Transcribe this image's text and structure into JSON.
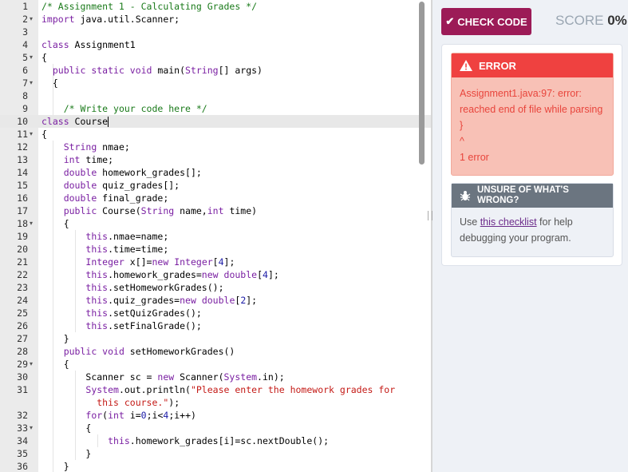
{
  "editor": {
    "lines": [
      {
        "n": "1",
        "fold": "",
        "indent": 0,
        "html": "<span class='cm'>/* Assignment 1 - Calculating Grades */</span>"
      },
      {
        "n": "2",
        "fold": "▾",
        "indent": 0,
        "html": "<span class='kw'>import</span> java.util.Scanner;"
      },
      {
        "n": "3",
        "fold": "",
        "indent": 0,
        "html": ""
      },
      {
        "n": "4",
        "fold": "",
        "indent": 0,
        "html": "<span class='kw'>class</span> Assignment1"
      },
      {
        "n": "5",
        "fold": "▾",
        "indent": 0,
        "html": "{"
      },
      {
        "n": "6",
        "fold": "",
        "indent": 1,
        "html": "  <span class='kw'>public static void</span> main(<span class='kw'>String</span>[] args)"
      },
      {
        "n": "7",
        "fold": "▾",
        "indent": 1,
        "html": "  {"
      },
      {
        "n": "8",
        "fold": "",
        "indent": 1,
        "html": ""
      },
      {
        "n": "9",
        "fold": "",
        "indent": 1,
        "html": "    <span class='cm'>/* Write your code here */</span>"
      },
      {
        "n": "10",
        "fold": "",
        "indent": 0,
        "active": true,
        "html": "<span class='kw'>class</span> Course<span class='cursor'></span>"
      },
      {
        "n": "11",
        "fold": "▾",
        "indent": 0,
        "html": "{"
      },
      {
        "n": "12",
        "fold": "",
        "indent": 1,
        "html": "    <span class='kw'>String</span> nmae;"
      },
      {
        "n": "13",
        "fold": "",
        "indent": 1,
        "html": "    <span class='kw'>int</span> time;"
      },
      {
        "n": "14",
        "fold": "",
        "indent": 1,
        "html": "    <span class='kw'>double</span> homework_grades[];"
      },
      {
        "n": "15",
        "fold": "",
        "indent": 1,
        "html": "    <span class='kw'>double</span> quiz_grades[];"
      },
      {
        "n": "16",
        "fold": "",
        "indent": 1,
        "html": "    <span class='kw'>double</span> final_grade;"
      },
      {
        "n": "17",
        "fold": "",
        "indent": 1,
        "html": "    <span class='kw'>public</span> Course(<span class='kw'>String</span> name,<span class='kw'>int</span> time)"
      },
      {
        "n": "18",
        "fold": "▾",
        "indent": 1,
        "html": "    {"
      },
      {
        "n": "19",
        "fold": "",
        "indent": 2,
        "html": "        <span class='kw'>this</span>.nmae=name;"
      },
      {
        "n": "20",
        "fold": "",
        "indent": 2,
        "html": "        <span class='kw'>this</span>.time=time;"
      },
      {
        "n": "21",
        "fold": "",
        "indent": 2,
        "html": "        <span class='kw'>Integer</span> x[]=<span class='kw'>new</span> <span class='kw'>Integer</span>[<span class='num'>4</span>];"
      },
      {
        "n": "22",
        "fold": "",
        "indent": 2,
        "html": "        <span class='kw'>this</span>.homework_grades=<span class='kw'>new</span> <span class='kw'>double</span>[<span class='num'>4</span>];"
      },
      {
        "n": "23",
        "fold": "",
        "indent": 2,
        "html": "        <span class='kw'>this</span>.setHomeworkGrades();"
      },
      {
        "n": "24",
        "fold": "",
        "indent": 2,
        "html": "        <span class='kw'>this</span>.quiz_grades=<span class='kw'>new</span> <span class='kw'>double</span>[<span class='num'>2</span>];"
      },
      {
        "n": "25",
        "fold": "",
        "indent": 2,
        "html": "        <span class='kw'>this</span>.setQuizGrades();"
      },
      {
        "n": "26",
        "fold": "",
        "indent": 2,
        "html": "        <span class='kw'>this</span>.setFinalGrade();"
      },
      {
        "n": "27",
        "fold": "",
        "indent": 1,
        "html": "    }"
      },
      {
        "n": "28",
        "fold": "",
        "indent": 1,
        "html": "    <span class='kw'>public void</span> setHomeworkGrades()"
      },
      {
        "n": "29",
        "fold": "▾",
        "indent": 1,
        "html": "    {"
      },
      {
        "n": "30",
        "fold": "",
        "indent": 2,
        "html": "        Scanner sc = <span class='kw'>new</span> Scanner(<span class='kw'>System</span>.in);"
      },
      {
        "n": "31",
        "fold": "",
        "indent": 2,
        "wrap": true,
        "html": "        <span class='kw'>System</span>.out.println(<span class='str'>\"Please enter the homework grades for\n          this course.\"</span>);"
      },
      {
        "n": "32",
        "fold": "",
        "indent": 2,
        "html": "        <span class='kw'>for</span>(<span class='kw'>int</span> i=<span class='num'>0</span>;i&lt;<span class='num'>4</span>;i++)"
      },
      {
        "n": "33",
        "fold": "▾",
        "indent": 2,
        "html": "        {"
      },
      {
        "n": "34",
        "fold": "",
        "indent": 3,
        "html": "            <span class='kw'>this</span>.homework_grades[i]=sc.nextDouble();"
      },
      {
        "n": "35",
        "fold": "",
        "indent": 2,
        "html": "        }"
      },
      {
        "n": "36",
        "fold": "",
        "indent": 1,
        "html": "    }"
      }
    ]
  },
  "toolbar": {
    "check_label": "CHECK CODE",
    "score_label": "SCORE",
    "score_value": "0%"
  },
  "error": {
    "title": "ERROR",
    "lines": [
      "Assignment1.java:97: error:",
      "reached end of file while parsing",
      "}",
      "^",
      "1 error"
    ]
  },
  "help": {
    "title": "UNSURE OF WHAT'S WRONG?",
    "pre": "Use ",
    "link": "this checklist",
    "post": " for help debugging your program."
  },
  "icons": {
    "check": "checkmark-icon",
    "warning": "warning-icon",
    "bug": "bug-icon"
  },
  "colors": {
    "check_button": "#9c1b57",
    "error_header": "#ef4140",
    "error_body": "#f8c1b6",
    "help_header": "#6b7580"
  }
}
